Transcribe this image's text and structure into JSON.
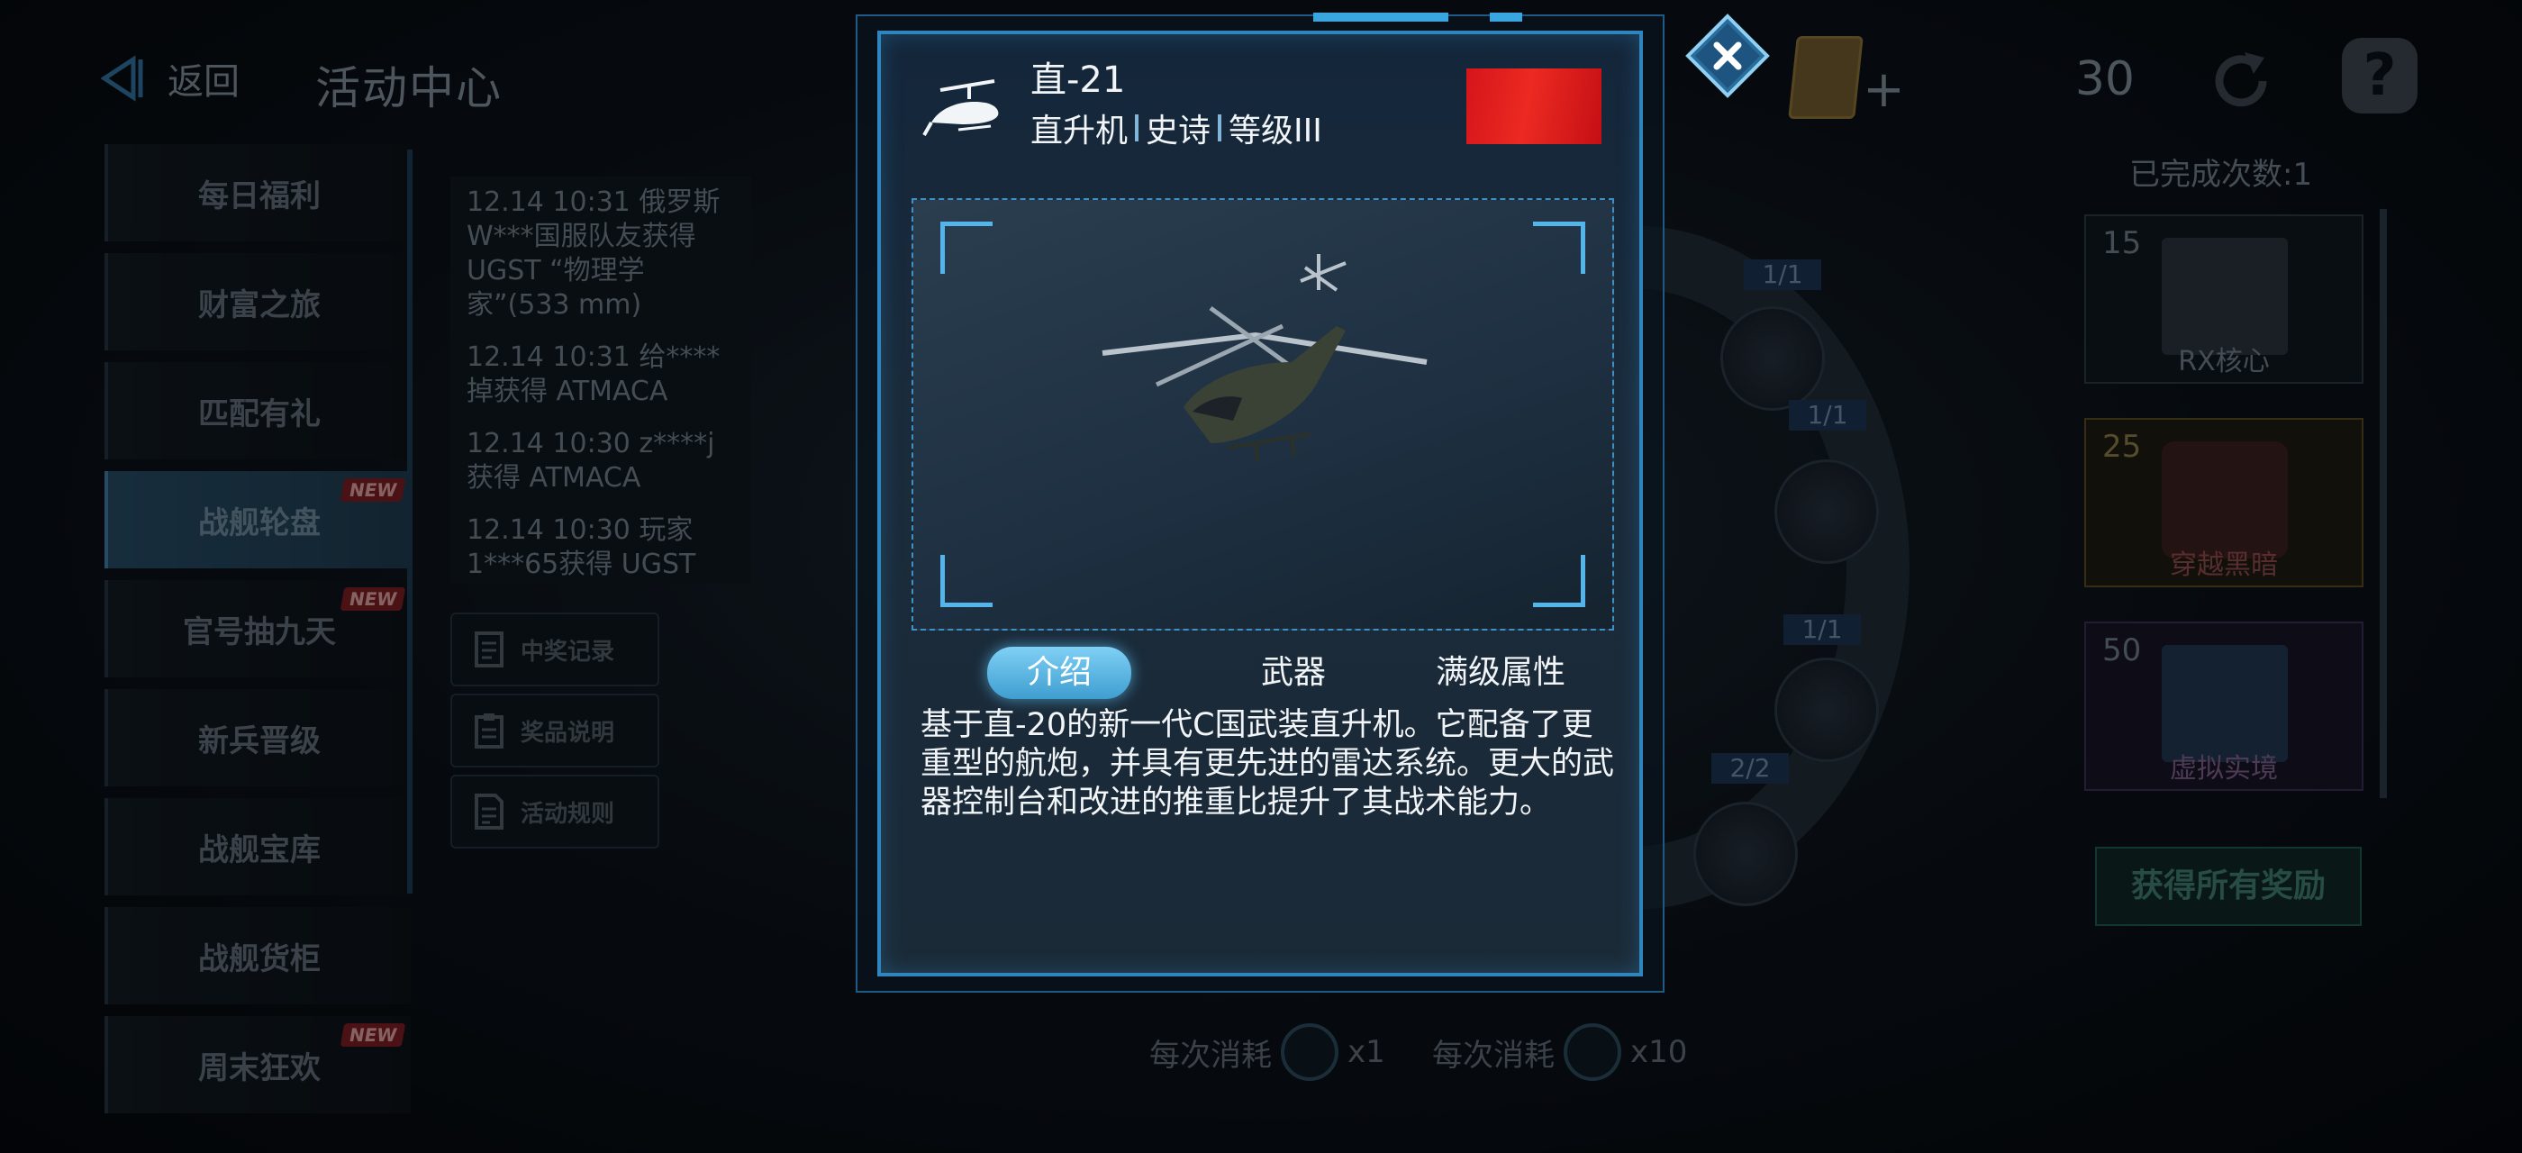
{
  "header": {
    "back_label": "返回",
    "title": "活动中心"
  },
  "currency": {
    "value": "30",
    "plus": "+"
  },
  "sidebar": {
    "items": [
      {
        "label": "每日福利",
        "badge": ""
      },
      {
        "label": "财富之旅",
        "badge": ""
      },
      {
        "label": "匹配有礼",
        "badge": ""
      },
      {
        "label": "战舰轮盘",
        "badge": "NEW"
      },
      {
        "label": "官号抽九天",
        "badge": "NEW"
      },
      {
        "label": "新兵晋级",
        "badge": ""
      },
      {
        "label": "战舰宝库",
        "badge": ""
      },
      {
        "label": "战舰货柜",
        "badge": ""
      },
      {
        "label": "周末狂欢",
        "badge": "NEW"
      }
    ]
  },
  "ticker": {
    "entries": [
      "12.14 10:31 俄罗斯W***国服队友获得 UGST “物理学家”(533 mm)",
      "12.14 10:31 给****掉获得 ATMACA",
      "12.14 10:30 z****j获得 ATMACA",
      "12.14 10:30 玩家1***65获得 UGST"
    ]
  },
  "left_buttons": {
    "records": "中奖记录",
    "prize_info": "奖品说明",
    "rules": "活动规则"
  },
  "wheel": {
    "counts": [
      "1/1",
      "1/1",
      "1/1",
      "2/2"
    ]
  },
  "rewards_panel": {
    "completed_label": "已完成次数:1",
    "items": [
      {
        "count": "15",
        "name": "RX核心"
      },
      {
        "count": "25",
        "name": "穿越黑暗"
      },
      {
        "count": "50",
        "name": "虚拟实境"
      }
    ],
    "claim_all_label": "获得所有奖励"
  },
  "costs": {
    "single_label": "每次消耗",
    "single_mult": "x1",
    "ten_label": "每次消耗",
    "ten_mult": "x10"
  },
  "modal": {
    "unit_name": "直-21",
    "tags": [
      "直升机",
      "史诗",
      "等级III"
    ],
    "tabs": {
      "intro": "介绍",
      "weapons": "武器",
      "max_stats": "满级属性"
    },
    "active_tab": "介绍",
    "description": "基于直-20的新一代C国武装直升机。它配备了更重型的航炮，并具有更先进的雷达系统。更大的武器控制台和改进的推重比提升了其战术能力。",
    "accent_color": "#2f86bf",
    "flag_color": "#e3201f"
  },
  "icons": {
    "close": "close-icon",
    "help": "?",
    "refresh": "refresh-icon"
  }
}
